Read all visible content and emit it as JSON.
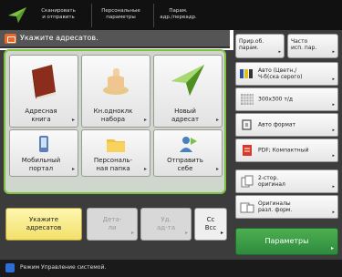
{
  "topbar": {
    "tabs": [
      {
        "line1": "Сканировать",
        "line2": "и отправить"
      },
      {
        "line1": "Персональные",
        "line2": "параметры"
      },
      {
        "line1": "Парам.",
        "line2": "адр./переадр."
      }
    ]
  },
  "title": {
    "text": "Укажите адресатов."
  },
  "destinations": {
    "address_book": {
      "line1": "Адресная",
      "line2": "книга"
    },
    "one_touch": {
      "line1": "Кн.одноклк",
      "line2": "набора"
    },
    "new_dest": {
      "line1": "Новый",
      "line2": "адресат"
    },
    "mobile": {
      "line1": "Мобильный",
      "line2": "портал"
    },
    "personal_folder": {
      "line1": "Персональ-",
      "line2": "ная папка"
    },
    "send_self": {
      "line1": "Отправить",
      "line2": "себе"
    }
  },
  "selector": {
    "specify": {
      "line1": "Укажите",
      "line2": "адресатов"
    },
    "detail": {
      "line1": "Дета-",
      "line2": "ли"
    },
    "delete": {
      "line1": "Уд.",
      "line2": "ад-та"
    },
    "cc": {
      "line1": "Cc",
      "line2": "Bcc"
    }
  },
  "quick": {
    "favorites": {
      "line1": "Прир.об.",
      "line2": "парам."
    },
    "frequent": {
      "line1": "Часто",
      "line2": "исп. пар."
    }
  },
  "options": [
    {
      "icon": "color-mode-icon",
      "line1": "Авто (Цветн./",
      "line2": "Ч-б(ска серого)"
    },
    {
      "icon": "resolution-icon",
      "line1": "300x300 т/д",
      "line2": ""
    },
    {
      "icon": "auto-format-icon",
      "line1": "Авто формат",
      "line2": ""
    },
    {
      "icon": "pdf-icon",
      "line1": "PDF; Компактный",
      "line2": ""
    },
    {
      "icon": "two-sided-icon",
      "line1": "2-стор.",
      "line2": "оригинал"
    },
    {
      "icon": "mixed-size-icon",
      "line1": "Оригиналы",
      "line2": "разл. форм."
    }
  ],
  "params_button": {
    "label": "Параметры"
  },
  "status": {
    "text": "Режим Управление системой."
  },
  "colors": {
    "accent_green": "#7ec040",
    "title_icon": "#e8682a",
    "active_selector": "#f2e06a",
    "params": "#2e8b3e",
    "status_icon": "#2d6fd8"
  }
}
